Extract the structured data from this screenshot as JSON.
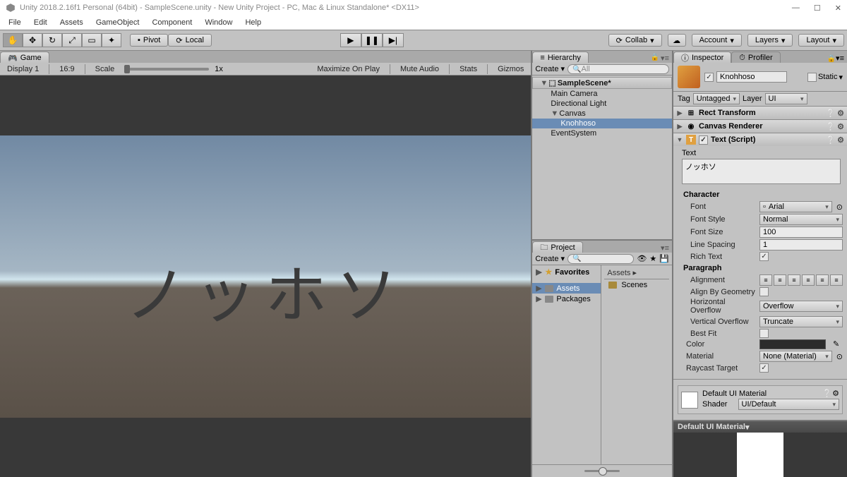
{
  "titlebar": {
    "title": "Unity 2018.2.16f1 Personal (64bit) - SampleScene.unity - New Unity Project - PC, Mac & Linux Standalone* <DX11>"
  },
  "menubar": [
    "File",
    "Edit",
    "Assets",
    "GameObject",
    "Component",
    "Window",
    "Help"
  ],
  "toolbar": {
    "pivot": "Pivot",
    "local": "Local",
    "collab": "Collab",
    "account": "Account",
    "layers": "Layers",
    "layout": "Layout"
  },
  "gamePanel": {
    "tab": "Game",
    "display": "Display 1",
    "aspect": "16:9",
    "scaleLabel": "Scale",
    "scaleValue": "1x",
    "maximize": "Maximize On Play",
    "mute": "Mute Audio",
    "stats": "Stats",
    "gizmos": "Gizmos",
    "sceneText": "ノッホソ"
  },
  "hierarchy": {
    "tab": "Hierarchy",
    "create": "Create",
    "searchPlaceholder": "All",
    "scene": "SampleScene*",
    "items": [
      {
        "name": "Main Camera",
        "indent": 1
      },
      {
        "name": "Directional Light",
        "indent": 1
      },
      {
        "name": "Canvas",
        "indent": 1,
        "fold": "▼"
      },
      {
        "name": "Knohhoso",
        "indent": 2,
        "selected": true
      },
      {
        "name": "EventSystem",
        "indent": 1
      }
    ]
  },
  "project": {
    "tab": "Project",
    "create": "Create",
    "favorites": "Favorites",
    "assets": "Assets",
    "packages": "Packages",
    "breadcrumb": "Assets",
    "folder": "Scenes"
  },
  "inspector": {
    "tabs": [
      "Inspector",
      "Profiler"
    ],
    "objectName": "Knohhoso",
    "static": "Static",
    "tagLabel": "Tag",
    "tagValue": "Untagged",
    "layerLabel": "Layer",
    "layerValue": "UI",
    "components": {
      "rect": "Rect Transform",
      "canvas": "Canvas Renderer",
      "text": "Text (Script)"
    },
    "textComp": {
      "textLabel": "Text",
      "textValue": "ノッホソ",
      "character": "Character",
      "font": "Font",
      "fontValue": "Arial",
      "fontStyle": "Font Style",
      "fontStyleValue": "Normal",
      "fontSize": "Font Size",
      "fontSizeValue": "100",
      "lineSpacing": "Line Spacing",
      "lineSpacingValue": "1",
      "richText": "Rich Text",
      "paragraph": "Paragraph",
      "alignment": "Alignment",
      "alignByGeom": "Align By Geometry",
      "hOverflow": "Horizontal Overflow",
      "hOverflowValue": "Overflow",
      "vOverflow": "Vertical Overflow",
      "vOverflowValue": "Truncate",
      "bestFit": "Best Fit",
      "color": "Color",
      "material": "Material",
      "materialValue": "None (Material)",
      "raycast": "Raycast Target"
    },
    "defaultMat": "Default UI Material",
    "shader": "Shader",
    "shaderValue": "UI/Default",
    "previewTitle": "Default UI Material"
  }
}
